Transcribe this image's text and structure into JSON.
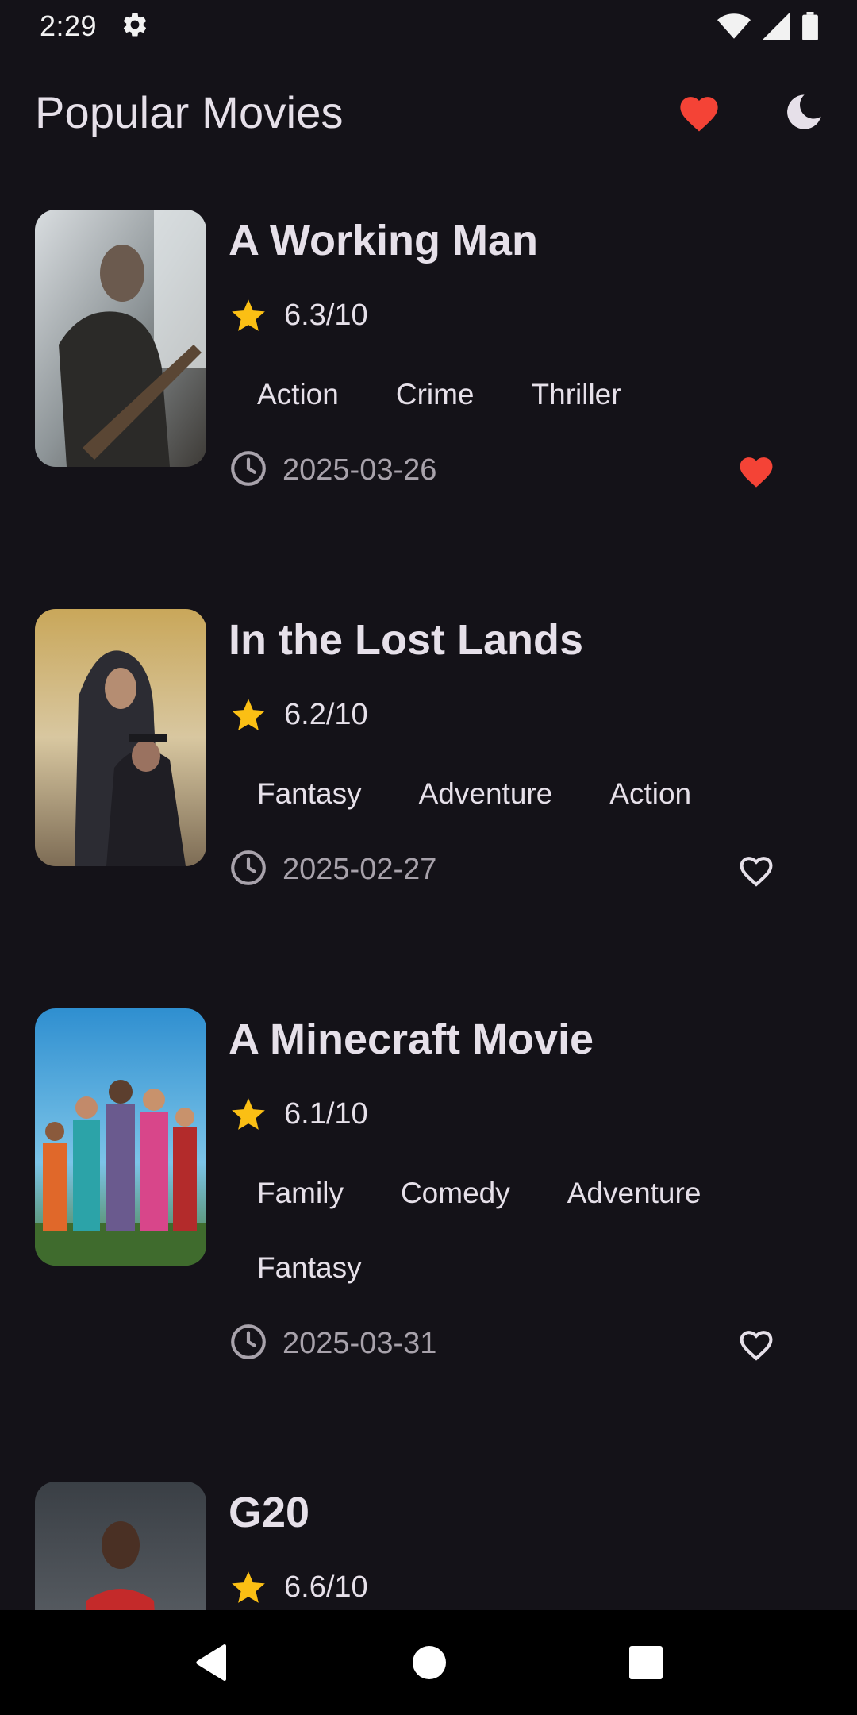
{
  "status_bar": {
    "time": "2:29"
  },
  "app_bar": {
    "title": "Popular Movies"
  },
  "colors": {
    "background": "#141218",
    "accent_red": "#f44336",
    "star_yellow": "#fbbf14",
    "text_primary": "#e6e0e9",
    "text_secondary": "#a8a2ab"
  },
  "movies": [
    {
      "title": "A Working Man",
      "rating": "6.3/10",
      "genres": [
        "Action",
        "Crime",
        "Thriller"
      ],
      "release_date": "2025-03-26",
      "favorite": true
    },
    {
      "title": "In the Lost Lands",
      "rating": "6.2/10",
      "genres": [
        "Fantasy",
        "Adventure",
        "Action"
      ],
      "release_date": "2025-02-27",
      "favorite": false
    },
    {
      "title": "A Minecraft Movie",
      "rating": "6.1/10",
      "genres": [
        "Family",
        "Comedy",
        "Adventure",
        "Fantasy"
      ],
      "release_date": "2025-03-31",
      "favorite": false
    },
    {
      "title": "G20",
      "rating": "6.6/10",
      "genres": [],
      "release_date": "",
      "favorite": false
    }
  ]
}
